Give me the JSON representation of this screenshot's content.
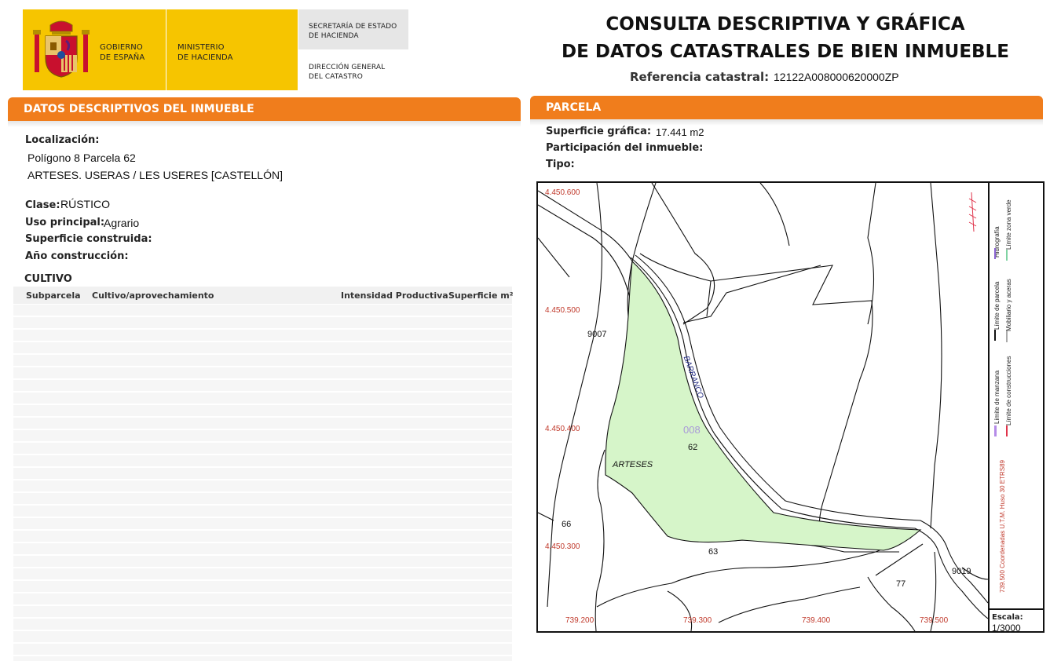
{
  "header": {
    "gobierno": "GOBIERNO\nDE ESPAÑA",
    "ministerio": "MINISTERIO\nDE HACIENDA",
    "secretaria": "SECRETARÍA DE ESTADO\nDE HACIENDA",
    "direccion": "DIRECCIÓN GENERAL\nDEL CATASTRO",
    "title": "CONSULTA DESCRIPTIVA Y GRÁFICA\nDE DATOS CATASTRALES DE BIEN INMUEBLE",
    "refcat_label": "Referencia catastral:",
    "refcat_value": "12122A008000620000ZP"
  },
  "datos": {
    "section_title": "DATOS DESCRIPTIVOS DEL INMUEBLE",
    "localizacion_label": "Localización:",
    "localizacion_line1": "Polígono 8 Parcela 62",
    "localizacion_line2": "ARTESES. USERAS / LES USERES [CASTELLÓN]",
    "clase_label": "Clase:",
    "clase_value": "RÚSTICO",
    "uso_label": "Uso principal:",
    "uso_value": "Agrario",
    "sup_construida_label": "Superficie construida:",
    "anio_label": "Año construcción:"
  },
  "cultivo": {
    "title": "CULTIVO",
    "columns": [
      "Subparcela",
      "Cultivo/aprovechamiento",
      "Intensidad Productiva",
      "Superficie m²"
    ]
  },
  "parcela": {
    "section_title": "PARCELA",
    "sup_grafica_label": "Superficie gráfica:",
    "sup_grafica_value": "17.441 m2",
    "participacion_label": "Participación del inmueble:",
    "tipo_label": "Tipo:"
  },
  "map": {
    "y_coords": [
      "4.450.600",
      "4.450.500",
      "4.450.400",
      "4.450.300"
    ],
    "x_coords": [
      "739.200",
      "739.300",
      "739.400",
      "739.500"
    ],
    "labels": {
      "parcel_9007": "9007",
      "barranco": "BARRANCO",
      "zone_008": "008",
      "parcel_62": "62",
      "arteses": "ARTESES",
      "parcel_66": "66",
      "parcel_63": "63",
      "parcel_77": "77",
      "parcel_9019": "9019"
    },
    "legend": {
      "hidrografia": "Hidrografía",
      "limite_zona_verde": "Límite zona verde",
      "limite_parcela": "Límite de parcela",
      "mobiliario": "Mobiliario y aceras",
      "limite_manzana": "Límite de manzana",
      "limite_construcciones": "Límite de construcciones",
      "coordenadas": "739.500 Coordenadas U.T.M. Huso 30 ETRS89"
    },
    "escala_label": "Escala:",
    "escala_value": "1/3000",
    "colors": {
      "parcel_fill": "#d6f5c9",
      "coord_red": "#c0392b",
      "legend_purple": "#8a63d2",
      "legend_green": "#7fd3a3",
      "legend_red": "#e0334a"
    }
  }
}
